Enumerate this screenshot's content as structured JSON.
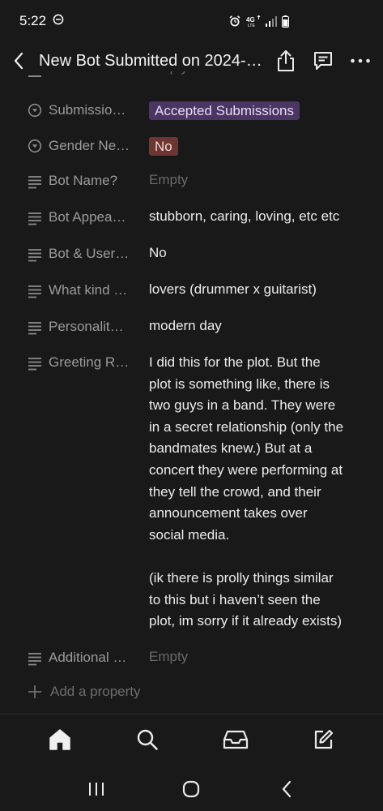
{
  "status_bar": {
    "time": "5:22",
    "network": "4G LTE"
  },
  "header": {
    "title": "New Bot Submitted on 2024-…"
  },
  "properties": [
    {
      "icon": "select-icon",
      "name": "Submissio…",
      "type": "tag",
      "value": "Accepted Submissions",
      "tag_color": "#4a3563"
    },
    {
      "icon": "select-icon",
      "name": "Gender Ne…",
      "type": "tag",
      "value": "No",
      "tag_color": "#6e3630"
    },
    {
      "icon": "text-icon",
      "name": "Bot Name?",
      "type": "text",
      "value": "Empty",
      "empty": true
    },
    {
      "icon": "text-icon",
      "name": "Bot Appea…",
      "type": "text",
      "value": "stubborn, caring, loving, etc etc"
    },
    {
      "icon": "text-icon",
      "name": "Bot & User…",
      "type": "text",
      "value": "No"
    },
    {
      "icon": "text-icon",
      "name": "What kind …",
      "type": "text",
      "value": "lovers (drummer x guitarist)"
    },
    {
      "icon": "text-icon",
      "name": "Personalit…",
      "type": "text",
      "value": "modern day"
    },
    {
      "icon": "text-icon",
      "name": "Greeting R…",
      "type": "text",
      "value_lines": [
        "I did this for the plot. But the",
        "plot is something like, there is",
        "two guys in a band. They were",
        "in a secret relationship (only the",
        "bandmates knew.) But at a",
        "concert they were performing at",
        "they tell the crowd, and their",
        "announcement takes over",
        "social media.",
        "",
        "(ik there is prolly things similar",
        "to this but i haven’t seen the",
        "plot, im sorry if it already exists)"
      ]
    },
    {
      "icon": "text-icon",
      "name": "Additional …",
      "type": "text",
      "value": "Empty",
      "empty": true
    }
  ],
  "add_property_label": "Add a property",
  "bottom_nav": [
    "home-icon",
    "search-icon",
    "inbox-icon",
    "new-page-icon"
  ],
  "system_nav": [
    "recents-icon",
    "home-circle-icon",
    "back-icon"
  ]
}
